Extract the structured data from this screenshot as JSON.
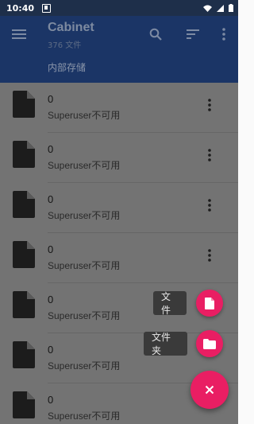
{
  "status_bar": {
    "time": "10:40"
  },
  "toolbar": {
    "title": "Cabinet",
    "subtitle": "376 文件",
    "breadcrumb": "内部存储"
  },
  "rows": [
    {
      "name": "0",
      "desc": "Superuser不可用"
    },
    {
      "name": "0",
      "desc": "Superuser不可用"
    },
    {
      "name": "0",
      "desc": "Superuser不可用"
    },
    {
      "name": "0",
      "desc": "Superuser不可用"
    },
    {
      "name": "0",
      "desc": "Superuser不可用"
    },
    {
      "name": "0",
      "desc": "Superuser不可用"
    },
    {
      "name": "0",
      "desc": "Superuser不可用"
    }
  ],
  "fab": {
    "file_label": "文件",
    "folder_label": "文件夹",
    "main_icon": "close-icon",
    "color": "#e91e63"
  },
  "icons": {
    "row_icon": "file-icon",
    "row_menu": "more-vert-icon"
  }
}
